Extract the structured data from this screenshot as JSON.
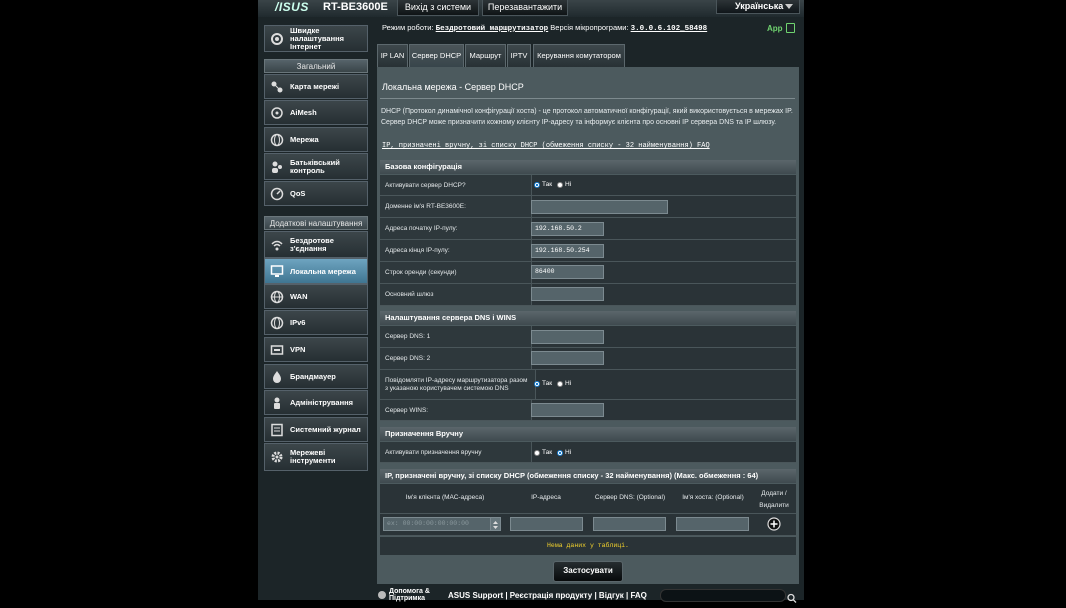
{
  "header": {
    "brand": "/ISUS",
    "model": "RT-BE3600E",
    "logout": "Вихід з системи",
    "reboot": "Перезавантажити",
    "language": "Українська"
  },
  "status": {
    "mode_label": "Режим роботи:",
    "mode_value": "Бездротовий маршрутизатор",
    "firmware_label": "Версія мікропрограми:",
    "firmware_value": "3.0.0.6.102_58498",
    "app_label": "App"
  },
  "sidebar": {
    "quick": "Швидке налаштування Інтернет",
    "general_header": "Загальний",
    "general": [
      "Карта мережі",
      "AiMesh",
      "Мережа",
      "Батьківський контроль",
      "QoS"
    ],
    "advanced_header": "Додаткові налаштування",
    "advanced": [
      "Бездротове з'єднання",
      "Локальна мережа",
      "WAN",
      "IPv6",
      "VPN",
      "Брандмауер",
      "Адміністрування",
      "Системний журнал",
      "Мережеві інструменти"
    ]
  },
  "tabs": [
    "IP LAN",
    "Сервер DHCP",
    "Маршрут",
    "IPTV",
    "Керування комутатором"
  ],
  "page": {
    "title": "Локальна мережа - Сервер DHCP",
    "description": "DHCP (Протокол динамічної конфігурації хоста) - це протокол автоматичної конфігурації, який використовується в мережах IP. Сервер DHCP може призначити кожному клієнту IP-адресу та інформує клієнта про основні IP сервера DNS та IP шлюзу.",
    "faq": "IP, призначені вручну, зі списку DHCP (обмеження списку - 32 найменування) FAQ"
  },
  "basic": {
    "header": "Базова конфігурація",
    "enable_label": "Активувати сервер DHCP?",
    "yes": "Так",
    "no": "Ні",
    "domain_label": "Доменне ім'я RT-BE3600E:",
    "domain_value": "",
    "start_label": "Адреса початку IP-пулу:",
    "start_value": "192.168.50.2",
    "end_label": "Адреса кінця IP-пулу:",
    "end_value": "192.168.50.254",
    "lease_label": "Строк оренди (секунди)",
    "lease_value": "86400",
    "gateway_label": "Основний шлюз",
    "gateway_value": ""
  },
  "dns": {
    "header": "Налаштування сервера DNS і WINS",
    "dns1_label": "Сервер DNS: 1",
    "dns2_label": "Сервер DNS: 2",
    "advertise_label": "Повідомляти IP-адресу маршрутизатора разом з указаною користувачем системою DNS",
    "wins_label": "Сервер WINS:"
  },
  "manual": {
    "header": "Призначення Вручну",
    "enable_label": "Активувати призначення вручну"
  },
  "list": {
    "header": "IP, призначені вручну, зі списку DHCP (обмеження списку - 32 найменування) (Макс. обмеження : 64)",
    "col_client": "Ім'я клієнта (МАС-адреса)",
    "col_ip": "IP-адреса",
    "col_dns": "Сервер DNS: (Optional)",
    "col_host": "Ім'я хоста: (Optional)",
    "col_action": "Додати / Видалити",
    "client_placeholder": "ex: 00:00:00:00:00:00",
    "empty": "Нема даних у таблиці."
  },
  "apply": "Застосувати",
  "footer": {
    "help": "Допомога & Підтримка",
    "links": "ASUS Support | Реєстрація продукту | Відгук | FAQ"
  }
}
